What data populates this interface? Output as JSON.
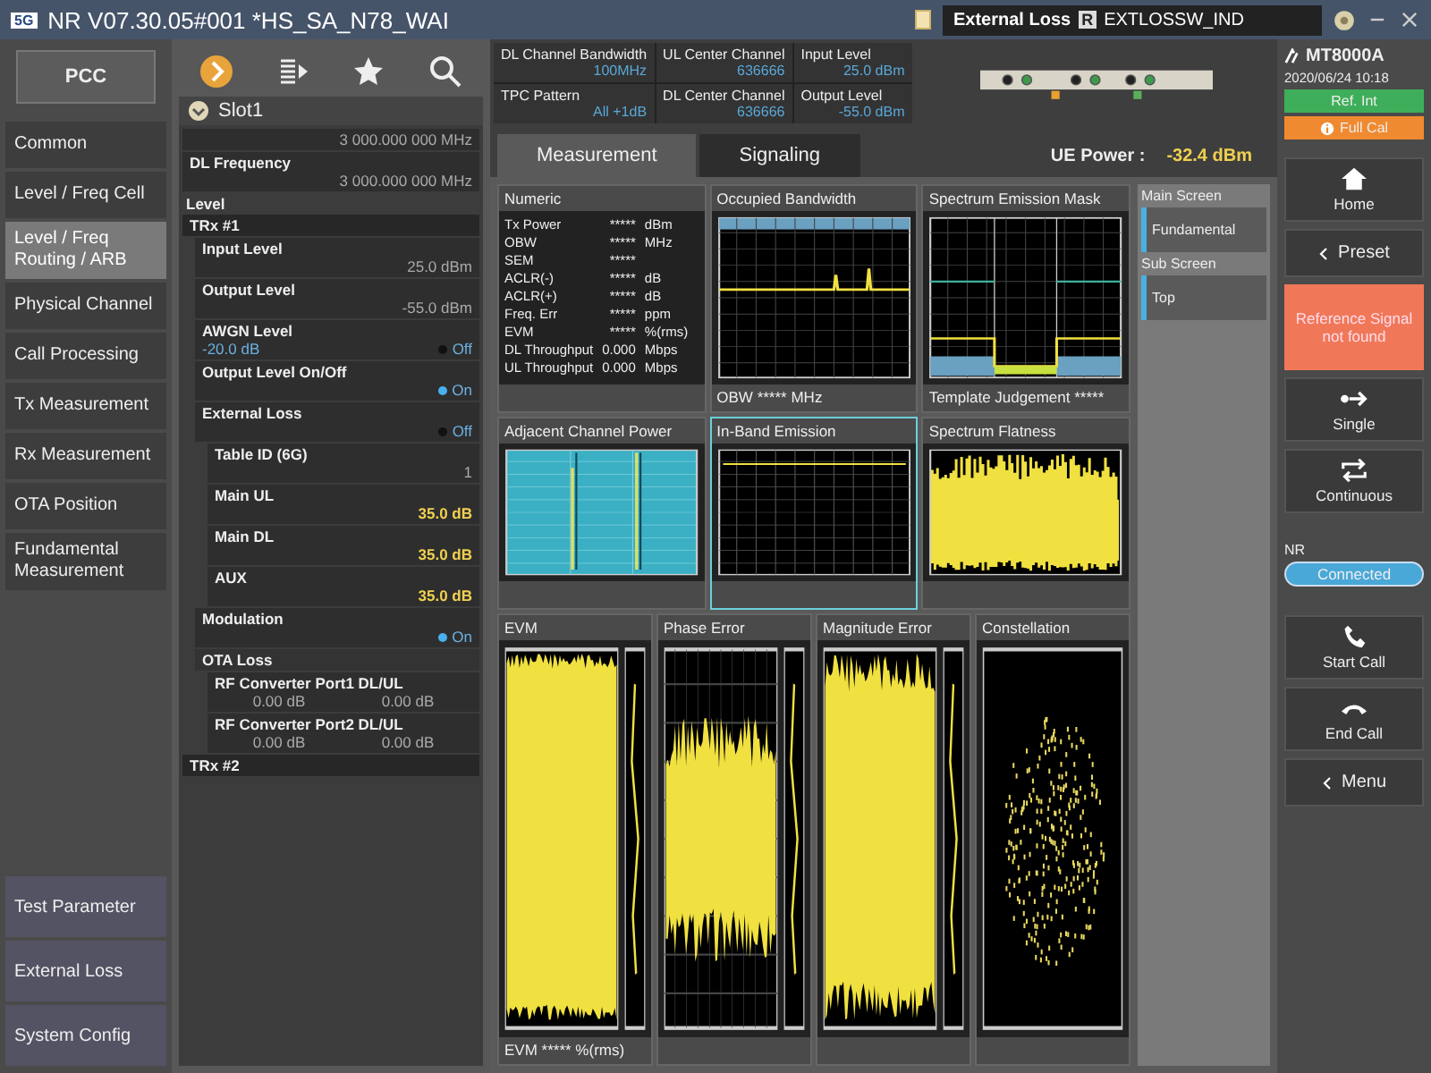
{
  "window": {
    "badge": "5G",
    "title": "NR V07.30.05#001  *HS_SA_N78_WAI",
    "center_label": "External Loss",
    "center_badge": "R",
    "center_value": "EXTLOSSW_IND"
  },
  "left_nav": {
    "top_button": "PCC",
    "items": [
      {
        "label": "Common",
        "selected": false
      },
      {
        "label": "Level / Freq Cell",
        "selected": false
      },
      {
        "label": "Level / Freq Routing / ARB",
        "selected": true
      },
      {
        "label": "Physical Channel",
        "selected": false
      },
      {
        "label": "Call Processing",
        "selected": false
      },
      {
        "label": "Tx Measurement",
        "selected": false
      },
      {
        "label": "Rx Measurement",
        "selected": false
      },
      {
        "label": "OTA Position",
        "selected": false
      },
      {
        "label": "Fundamental Measurement",
        "selected": false
      }
    ],
    "bottom_items": [
      {
        "label": "Test Parameter"
      },
      {
        "label": "External Loss"
      },
      {
        "label": "System Config"
      }
    ]
  },
  "parameters": {
    "section": "Slot1",
    "rows": [
      {
        "kind": "value-only",
        "value": "3 000.000 000 MHz"
      },
      {
        "kind": "field",
        "label": "DL Frequency",
        "value": "3 000.000 000 MHz",
        "highlighted": false
      },
      {
        "kind": "heading",
        "label": "Level"
      },
      {
        "kind": "group",
        "label": "TRx #1",
        "children": [
          {
            "kind": "field",
            "label": "Input Level",
            "value": "25.0 dBm",
            "highlighted": false
          },
          {
            "kind": "field",
            "label": "Output Level",
            "value": "-55.0 dBm",
            "highlighted": false
          },
          {
            "kind": "toggle-field",
            "label": "AWGN Level",
            "value": "-20.0 dB",
            "toggle": "Off",
            "on": false
          },
          {
            "kind": "toggle",
            "label": "Output Level On/Off",
            "toggle": "On",
            "on": true
          },
          {
            "kind": "toggle",
            "label": "External Loss",
            "toggle": "Off",
            "on": false,
            "children": [
              {
                "kind": "field",
                "label": "Table ID (6G)",
                "value": "1",
                "highlighted": false
              },
              {
                "kind": "field",
                "label": "Main UL",
                "value": "35.0 dB",
                "highlighted": true
              },
              {
                "kind": "field",
                "label": "Main DL",
                "value": "35.0 dB",
                "highlighted": true
              },
              {
                "kind": "field",
                "label": "AUX",
                "value": "35.0 dB",
                "highlighted": true
              }
            ]
          },
          {
            "kind": "toggle",
            "label": "Modulation",
            "toggle": "On",
            "on": true
          },
          {
            "kind": "subheading",
            "label": "OTA Loss",
            "children": [
              {
                "kind": "pair",
                "label": "RF Converter Port1 DL/UL",
                "values": [
                  "0.00 dB",
                  "0.00 dB"
                ]
              },
              {
                "kind": "pair",
                "label": "RF Converter Port2 DL/UL",
                "values": [
                  "0.00 dB",
                  "0.00 dB"
                ]
              }
            ]
          }
        ]
      },
      {
        "kind": "group",
        "label": "TRx #2"
      }
    ]
  },
  "header": {
    "cells": [
      {
        "label": "DL Channel Bandwidth",
        "value": "100MHz"
      },
      {
        "label": "UL Center Channel",
        "value": "636666"
      },
      {
        "label": "Input Level",
        "value": "25.0 dBm"
      },
      {
        "label": "TPC Pattern",
        "value": "All +1dB"
      },
      {
        "label": "DL Center Channel",
        "value": "636666"
      },
      {
        "label": "Output Level",
        "value": "-55.0 dBm"
      }
    ]
  },
  "tabs": [
    {
      "label": "Measurement",
      "selected": true
    },
    {
      "label": "Signaling",
      "selected": false
    }
  ],
  "ue_power": {
    "label": "UE Power :",
    "value": "-32.4 dBm"
  },
  "panels": [
    {
      "kind": "numeric",
      "title": "Numeric",
      "selected": false,
      "rows": [
        {
          "label": "Tx Power",
          "value": "*****",
          "unit": "dBm"
        },
        {
          "label": "OBW",
          "value": "*****",
          "unit": "MHz"
        },
        {
          "label": "SEM",
          "value": "*****"
        },
        {
          "label": "ACLR(-)",
          "value": "*****",
          "unit": "dB"
        },
        {
          "label": "ACLR(+)",
          "value": "*****",
          "unit": "dB"
        },
        {
          "label": "Freq. Err",
          "value": "*****",
          "unit": "ppm"
        },
        {
          "label": "EVM",
          "value": "*****",
          "unit": "%(rms)"
        },
        {
          "label": "DL Throughput",
          "value": "0.000",
          "unit": "Mbps"
        },
        {
          "label": "UL Throughput",
          "value": "0.000",
          "unit": "Mbps"
        }
      ]
    },
    {
      "kind": "obw",
      "title": "Occupied Bandwidth",
      "footer": "OBW  *****  MHz",
      "selected": false
    },
    {
      "kind": "sem",
      "title": "Spectrum Emission Mask",
      "footer": "Template Judgement  *****",
      "selected": false
    },
    {
      "kind": "acp",
      "title": "Adjacent Channel Power",
      "selected": false
    },
    {
      "kind": "inband",
      "title": "In-Band Emission",
      "selected": true
    },
    {
      "kind": "flatness",
      "title": "Spectrum Flatness",
      "selected": false
    },
    {
      "kind": "evm",
      "title": "EVM",
      "footer": "EVM  *****  %(rms)",
      "selected": false
    },
    {
      "kind": "phase",
      "title": "Phase Error",
      "selected": false
    },
    {
      "kind": "magnitude",
      "title": "Magnitude Error",
      "selected": false
    },
    {
      "kind": "constellation",
      "title": "Constellation",
      "selected": false
    }
  ],
  "screen_select": [
    {
      "label": "Main Screen",
      "value": "Fundamental"
    },
    {
      "label": "Sub Screen",
      "value": "Top"
    }
  ],
  "side": {
    "model": "MT8000A",
    "datetime": "2020/06/24 10:18",
    "badges": [
      {
        "label": "Ref. Int",
        "color": "#3fae5a",
        "kind": "plain"
      },
      {
        "label": "Full Cal",
        "color": "#f08a30",
        "kind": "info"
      }
    ],
    "buttons": [
      {
        "kind": "home",
        "label": "Home"
      },
      {
        "kind": "preset",
        "label": "Preset"
      },
      {
        "kind": "alert",
        "label": "Reference Signal not found"
      },
      {
        "kind": "single",
        "label": "Single"
      },
      {
        "kind": "continuous",
        "label": "Continuous"
      },
      {
        "kind": "status",
        "label": "NR",
        "value": "Connected"
      },
      {
        "kind": "start-call",
        "label": "Start Call"
      },
      {
        "kind": "end-call",
        "label": "End Call"
      },
      {
        "kind": "menu",
        "label": "Menu"
      }
    ]
  }
}
